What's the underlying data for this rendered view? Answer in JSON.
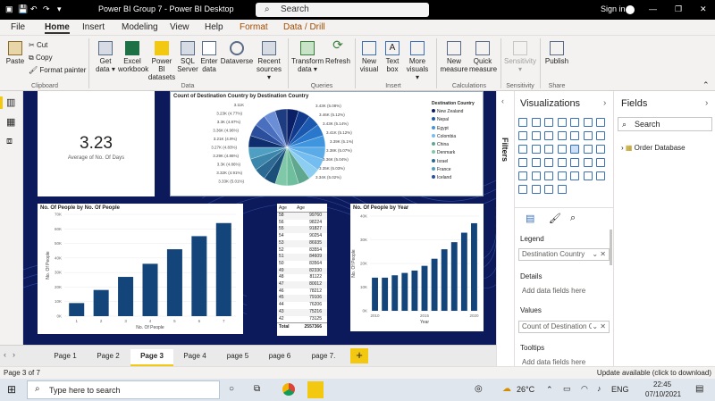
{
  "window": {
    "title": "Power BI Group 7 - Power BI Desktop",
    "search_label": "Search",
    "signin": "Sign in"
  },
  "menu": [
    "File",
    "Home",
    "Insert",
    "Modeling",
    "View",
    "Help",
    "Format",
    "Data / Drill"
  ],
  "ribbon": {
    "clipboard": {
      "paste": "Paste",
      "cut": "Cut",
      "copy": "Copy",
      "format_painter": "Format painter",
      "group": "Clipboard"
    },
    "data": {
      "items": [
        "Get data ▾",
        "Excel workbook",
        "Power BI datasets",
        "SQL Server",
        "Enter data",
        "Dataverse",
        "Recent sources ▾"
      ],
      "group": "Data"
    },
    "queries": {
      "items": [
        "Transform data ▾",
        "Refresh"
      ],
      "group": "Queries"
    },
    "insert": {
      "items": [
        "New visual",
        "Text box",
        "More visuals ▾"
      ],
      "group": "Insert"
    },
    "calculations": {
      "items": [
        "New measure",
        "Quick measure"
      ],
      "group": "Calculations"
    },
    "sensitivity": {
      "items": [
        "Sensitivity ▾"
      ],
      "group": "Sensitivity"
    },
    "share": {
      "items": [
        "Publish"
      ],
      "group": "Share"
    }
  },
  "kpi": {
    "value": "3.23",
    "label": "Average of No. Of Days"
  },
  "pie": {
    "title": "Count of Destination Country by Destination Country",
    "legend_title": "Destination Country",
    "legend": [
      "New Zealand",
      "Nepal",
      "Egypt",
      "Colombia",
      "China",
      "Denmark",
      "Israel",
      "France",
      "Iceland"
    ],
    "labels_left": [
      "3.11K",
      "3.23K (4.77%)",
      "3.3K (4.87%)",
      "3.36K (4.96%)",
      "3.21K (4.9%)",
      "3.27K (4.83%)",
      "3.29K (4.86%)",
      "3.3K (4.86%)",
      "3.32K (4.91%)",
      "3.33K (5.01%)"
    ],
    "labels_right": [
      "3.43K (5.08%)",
      "3.46K (5.12%)",
      "3.43K (5.14%)",
      "3.41K (5.12%)",
      "3.39K (5.1%)",
      "3.38K (5.07%)",
      "3.36K (5.04%)",
      "3.35K (5.03%)",
      "3.34K (5.02%)"
    ],
    "colors": [
      "#0b1f66",
      "#123a8c",
      "#1b58b0",
      "#2a78cc",
      "#3f95de",
      "#5aabe8",
      "#74bdf0",
      "#8ccdf2",
      "#5fa88f",
      "#6fbf9e",
      "#80c9a8",
      "#1a4f7a",
      "#2c6a93",
      "#3c86ac",
      "#4e9fc2",
      "#0e2e6e",
      "#2b4f9c",
      "#4a6fbf",
      "#6a8fd6",
      "#1d3c82"
    ],
    "chart_data": {
      "type": "pie",
      "title": "Count of Destination Country by Destination Country"
    }
  },
  "bar_people": {
    "title": "No. Of People by No. Of People",
    "chart_data": {
      "type": "bar",
      "categories": [
        "1",
        "2",
        "3",
        "4",
        "5",
        "6",
        "7"
      ],
      "values": [
        9,
        18,
        27,
        36,
        46,
        55,
        64
      ],
      "xlabel": "No. Of People",
      "ylabel": "No. Of People",
      "ylim": [
        0,
        70
      ],
      "yticks": [
        "0K",
        "10K",
        "20K",
        "30K",
        "40K",
        "50K",
        "60K",
        "70K"
      ]
    }
  },
  "table": {
    "headers": [
      "Age",
      "Age"
    ],
    "rows": [
      [
        "58",
        "99760"
      ],
      [
        "56",
        "98224"
      ],
      [
        "55",
        "91827"
      ],
      [
        "54",
        "90254"
      ],
      [
        "53",
        "86935"
      ],
      [
        "52",
        "83554"
      ],
      [
        "51",
        "84609"
      ],
      [
        "50",
        "83564"
      ],
      [
        "49",
        "82330"
      ],
      [
        "48",
        "81122"
      ],
      [
        "47",
        "80012"
      ],
      [
        "46",
        "78212"
      ],
      [
        "45",
        "79106"
      ],
      [
        "44",
        "76206"
      ],
      [
        "43",
        "75216"
      ],
      [
        "42",
        "73125"
      ]
    ],
    "total_label": "Total",
    "total_value": "2557366"
  },
  "bar_year": {
    "title": "No. Of People by Year",
    "chart_data": {
      "type": "bar",
      "categories": [
        "2010",
        "2011",
        "2012",
        "2013",
        "2014",
        "2015",
        "2016",
        "2017",
        "2018",
        "2019",
        "2020"
      ],
      "values": [
        14,
        14,
        15,
        16,
        17,
        19,
        22,
        26,
        29,
        33,
        37
      ],
      "xlabel": "Year",
      "ylabel": "No. Of People",
      "ylim": [
        0,
        40
      ],
      "yticks": [
        "0K",
        "10K",
        "20K",
        "30K",
        "40K"
      ],
      "xticks": [
        "2010",
        "2015",
        "2020"
      ]
    }
  },
  "pages": [
    "Page 1",
    "Page 2",
    "Page 3",
    "Page 4",
    "page 5",
    "page 6",
    "page 7."
  ],
  "active_page": 2,
  "status": {
    "left": "Page 3 of 7",
    "right": "Update available (click to download)"
  },
  "filters": {
    "label": "Filters"
  },
  "visualizations": {
    "title": "Visualizations",
    "legend_label": "Legend",
    "legend_field": "Destination Country",
    "details_label": "Details",
    "details_placeholder": "Add data fields here",
    "values_label": "Values",
    "values_field": "Count of Destination Cc",
    "tooltips_label": "Tooltips",
    "tooltips_placeholder": "Add data fields here"
  },
  "fields": {
    "title": "Fields",
    "search_placeholder": "Search",
    "tables": [
      "Order Database"
    ]
  },
  "taskbar": {
    "search": "Type here to search",
    "weather": "26°C",
    "lang": "ENG",
    "time": "22:45",
    "date": "07/10/2021"
  }
}
